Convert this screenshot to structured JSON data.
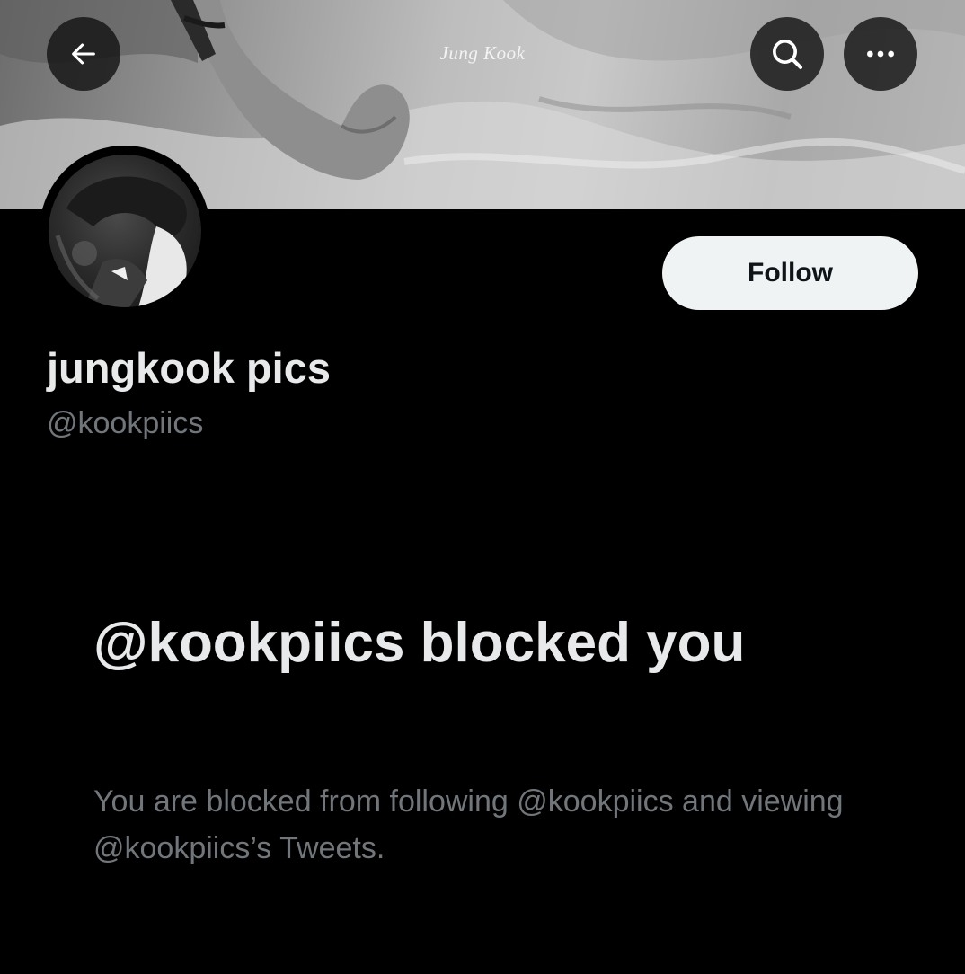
{
  "header": {
    "banner_caption": "Jung Kook",
    "back_icon": "arrow-left-icon",
    "search_icon": "search-icon",
    "more_icon": "more-horizontal-icon"
  },
  "profile": {
    "display_name": "jungkook pics",
    "handle": "@kookpiics",
    "follow_label": "Follow"
  },
  "blocked_notice": {
    "title": "@kookpiics blocked you",
    "description": "You are blocked from following @kookpiics and viewing @kookpiics’s Tweets."
  },
  "colors": {
    "background": "#000000",
    "primary_text": "#e7e9ea",
    "secondary_text": "#71767b",
    "follow_button_bg": "#eff3f4",
    "follow_button_text": "#0f1419"
  }
}
